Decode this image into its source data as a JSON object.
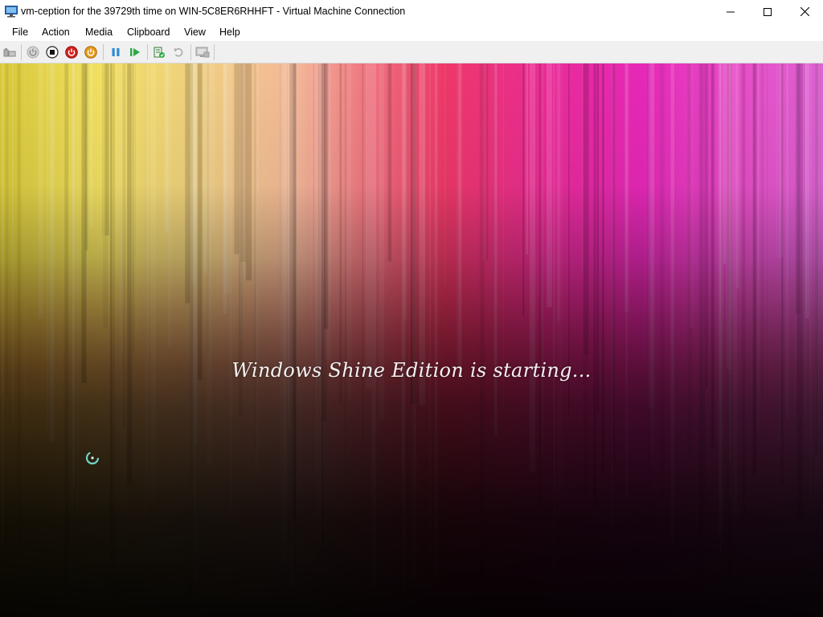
{
  "window": {
    "title": "vm-ception for the 39729th time on WIN-5C8ER6RHHFT - Virtual Machine Connection",
    "icon": "virtual-machine-icon",
    "controls": [
      "minimize-icon",
      "maximize-icon",
      "close-icon"
    ]
  },
  "menu": {
    "items": [
      {
        "label": "File"
      },
      {
        "label": "Action"
      },
      {
        "label": "Media"
      },
      {
        "label": "Clipboard"
      },
      {
        "label": "View"
      },
      {
        "label": "Help"
      }
    ]
  },
  "toolbar": {
    "buttons": [
      {
        "name": "ctrl-alt-del-button",
        "icon": "ctrl-alt-del-icon",
        "enabled": false
      },
      {
        "name": "start-button",
        "icon": "power-icon",
        "enabled": false
      },
      {
        "name": "turn-off-button",
        "icon": "stop-icon",
        "enabled": true
      },
      {
        "name": "shut-down-button",
        "icon": "shutdown-icon",
        "enabled": true,
        "color": "#d42020"
      },
      {
        "name": "save-button",
        "icon": "save-state-icon",
        "enabled": true,
        "color": "#e89a1c"
      },
      {
        "name": "pause-button",
        "icon": "pause-icon",
        "enabled": true,
        "color": "#2a8ad4"
      },
      {
        "name": "resume-button",
        "icon": "play-icon",
        "enabled": true,
        "color": "#2aa84a"
      },
      {
        "name": "checkpoint-button",
        "icon": "checkpoint-icon",
        "enabled": true
      },
      {
        "name": "revert-button",
        "icon": "revert-icon",
        "enabled": false
      },
      {
        "name": "enhanced-session-button",
        "icon": "enhanced-session-icon",
        "enabled": false
      }
    ]
  },
  "vm": {
    "boot_message": "Windows Shine Edition is starting...",
    "spinner_color": "#6fd6c8"
  }
}
